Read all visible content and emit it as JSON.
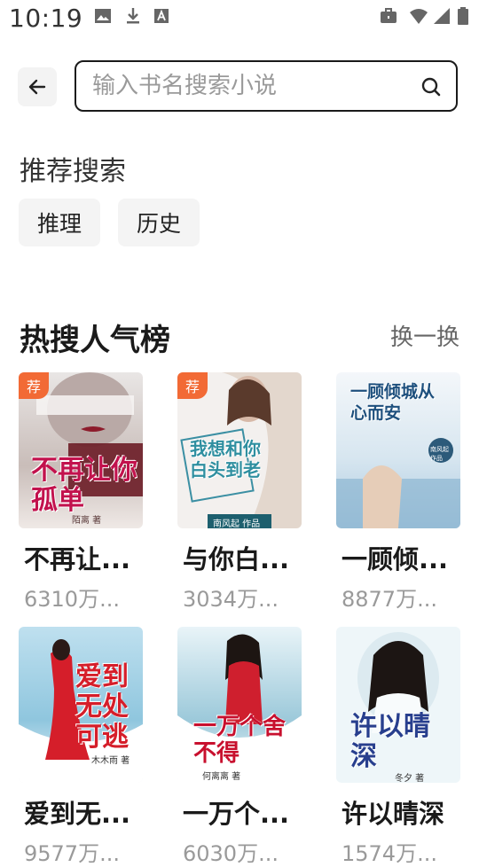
{
  "status_bar": {
    "time": "10:19",
    "left_icons": [
      "image-icon",
      "download-icon",
      "font-icon"
    ],
    "right_icons": [
      "briefcase-icon",
      "wifi-icon",
      "signal-icon",
      "battery-icon"
    ]
  },
  "search": {
    "placeholder": "输入书名搜索小说"
  },
  "recommended": {
    "title": "推荐搜索",
    "chips": [
      "推理",
      "历史"
    ]
  },
  "hot_list": {
    "title": "热搜人气榜",
    "refresh_label": "换一换",
    "badge_label": "荐",
    "books": [
      {
        "title": "不再让...",
        "heat": "6310万...",
        "badge": true,
        "cover_text": "不再让你孤单",
        "author": "陌离 著",
        "colors": [
          "#e9e6e5",
          "#b9a9a6",
          "#7a1d2a"
        ]
      },
      {
        "title": "与你白...",
        "heat": "3034万...",
        "badge": true,
        "cover_text": "我想和你白头到老",
        "author": "南风起 作品",
        "colors": [
          "#f3f0ee",
          "#dcd4cc",
          "#2f8fa0"
        ]
      },
      {
        "title": "一顾倾...",
        "heat": "8877万...",
        "badge": false,
        "cover_text": "一顾倾城从心而安",
        "author": "南风起 作品",
        "colors": [
          "#f4f7fa",
          "#c8dbe8",
          "#6e9ec2"
        ]
      },
      {
        "title": "爱到无...",
        "heat": "9577万...",
        "badge": false,
        "cover_text": "爱到无处可逃",
        "author": "木木雨 著",
        "colors": [
          "#d9eef6",
          "#8fc6de",
          "#d51e2a"
        ]
      },
      {
        "title": "一万个...",
        "heat": "6030万...",
        "badge": false,
        "cover_text": "一万个舍不得",
        "author": "何离离 著",
        "colors": [
          "#eaf4f8",
          "#9cc9da",
          "#d11e38"
        ]
      },
      {
        "title": "许以晴深",
        "heat": "1574万...",
        "badge": false,
        "cover_text": "许以晴深",
        "author": "冬夕 著",
        "colors": [
          "#f0f6f8",
          "#cfe2ea",
          "#2a3f8c"
        ]
      }
    ]
  }
}
